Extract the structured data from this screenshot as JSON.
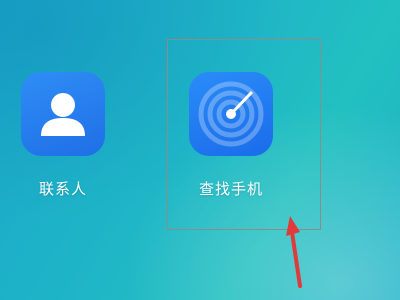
{
  "home_screen": {
    "apps": [
      {
        "label": "联系人",
        "icon": "contacts-icon"
      },
      {
        "label": "查找手机",
        "icon": "find-phone-radar-icon"
      }
    ]
  },
  "colors": {
    "wallpaper": "#1fb6c7",
    "app_icon_blue": "#1f6fe6",
    "highlight_box": "#8c8c8c",
    "arrow": "#e03a3a"
  }
}
